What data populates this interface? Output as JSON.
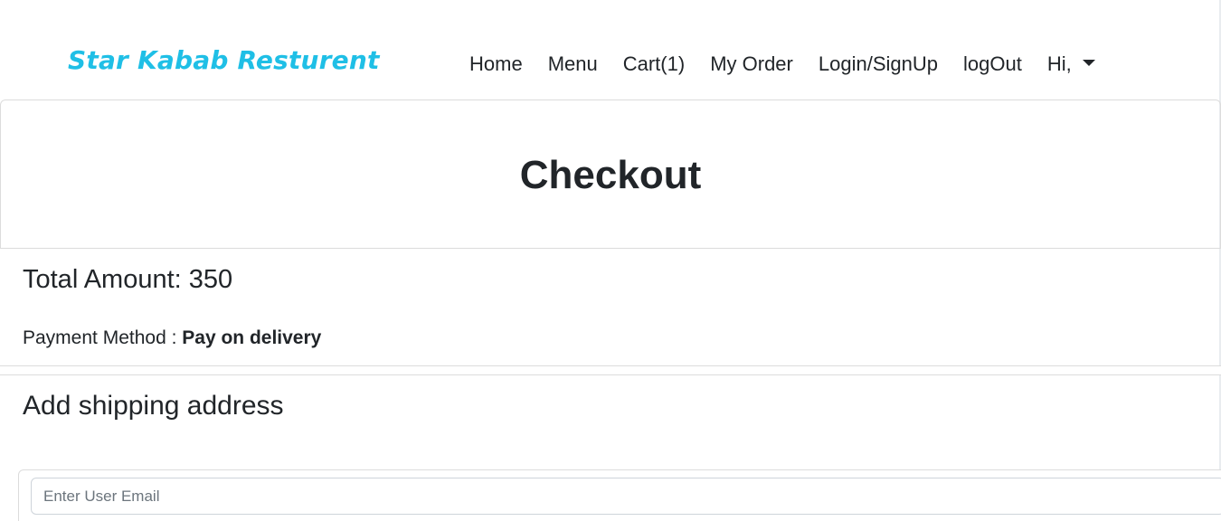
{
  "app": {
    "brand": "Star Kabab Resturent"
  },
  "nav": {
    "home": "Home",
    "menu": "Menu",
    "cart": "Cart(1)",
    "my_order": "My Order",
    "login_signup": "Login/SignUp",
    "logout": "logOut",
    "user_menu": "Hi,"
  },
  "checkout": {
    "title": "Checkout",
    "total_label": "Total Amount: ",
    "total_value": "350",
    "payment_label": "Payment Method : ",
    "payment_value": "Pay on delivery"
  },
  "shipping": {
    "title": "Add shipping address",
    "email_placeholder": "Enter User Email",
    "email_value": ""
  },
  "colors": {
    "brand": "#1fbfe6",
    "text": "#212529",
    "border": "#dcdcdc"
  },
  "icons": {
    "user_menu_indicator": "caret-down-icon"
  }
}
